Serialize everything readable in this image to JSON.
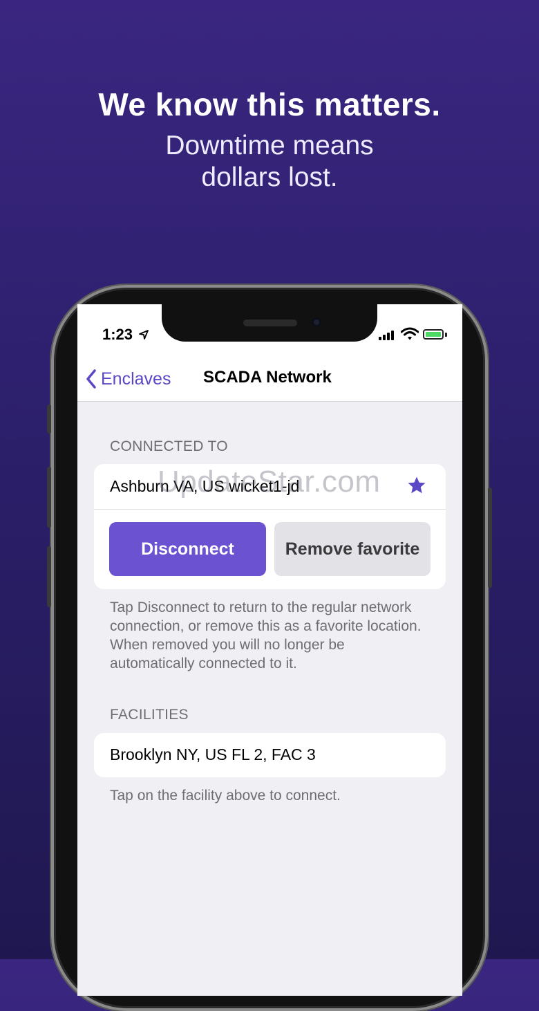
{
  "hero": {
    "title": "We know this matters.",
    "subtitle_line1": "Downtime means",
    "subtitle_line2": "dollars lost."
  },
  "status_bar": {
    "time": "1:23",
    "icons": [
      "location-arrow-icon",
      "cellular-signal-icon",
      "wifi-icon",
      "battery-icon"
    ]
  },
  "nav": {
    "back_label": "Enclaves",
    "title": "SCADA Network"
  },
  "connected": {
    "header": "CONNECTED TO",
    "location": "Ashburn VA, US wicket1-jd",
    "favorite": true,
    "disconnect_label": "Disconnect",
    "remove_favorite_label": "Remove favorite",
    "footnote": "Tap Disconnect to return to the regular network connection, or remove this as a favorite location. When removed you will no longer be automatically connected to it."
  },
  "facilities": {
    "header": "FACILITIES",
    "items": [
      "Brooklyn NY, US FL 2, FAC 3"
    ],
    "footnote": "Tap on the facility above to connect."
  },
  "watermark": "UpdateStar.com",
  "colors": {
    "accent": "#6b52d0",
    "background_top": "#3a2680",
    "background_bottom": "#1f1850"
  }
}
